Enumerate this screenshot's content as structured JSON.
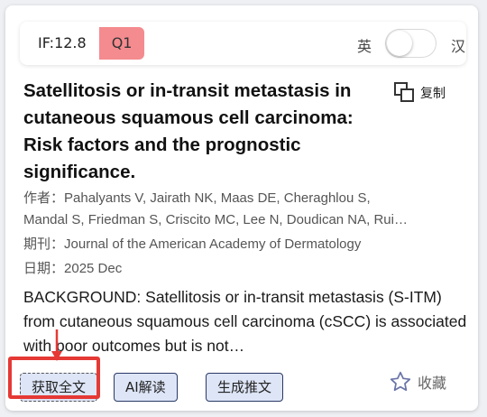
{
  "header": {
    "impact_factor": "IF:12.8",
    "quartile": "Q1",
    "quartile_color": "#f48b8f",
    "lang_left": "英",
    "lang_right": "汉"
  },
  "paper": {
    "title": "Satellitosis or in-transit metastasis in cutaneous squamous cell carcinoma: Risk factors and the prognostic significance.",
    "copy_label": "复制",
    "authors_label": "作者：",
    "authors_line1": "Pahalyants V, Jairath NK, Maas DE, Cheraghlou S,",
    "authors_line2": "Mandal S, Friedman S, Criscito MC, Lee N, Doudican NA, Rui…",
    "journal_label": "期刊：",
    "journal": "Journal of the American Academy of Dermatology",
    "date_label": "日期：",
    "date": "2025 Dec",
    "abstract": "BACKGROUND: Satellitosis or in-transit metastasis (S-ITM) from cutaneous squamous cell carcinoma (cSCC) is associated with poor outcomes but is not…"
  },
  "actions": {
    "fulltext": "获取全文",
    "ai_read": "AI解读",
    "generate_post": "生成推文",
    "favorite": "收藏"
  },
  "colors": {
    "highlight": "#e53935",
    "button_bg": "#dde5f7"
  }
}
